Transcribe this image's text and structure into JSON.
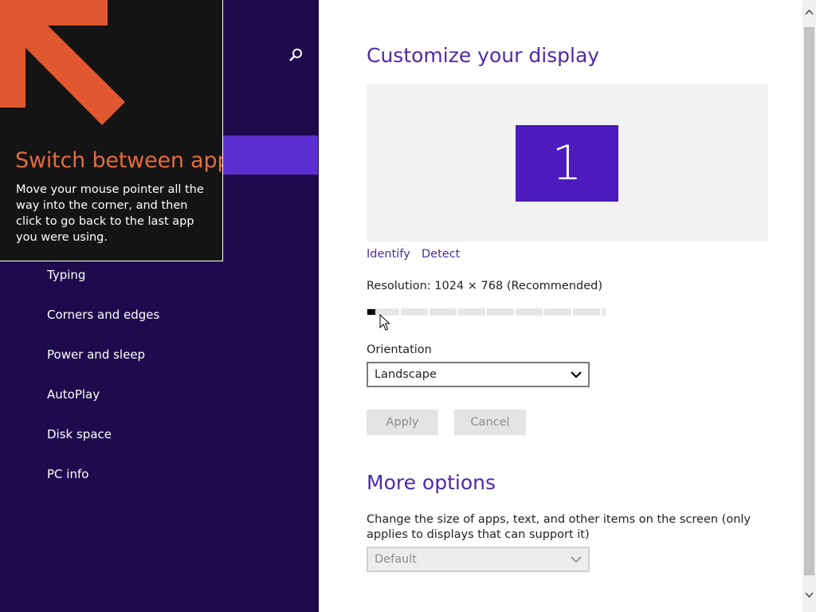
{
  "nav": {
    "items": [
      {
        "label": "Typing"
      },
      {
        "label": "Corners and edges"
      },
      {
        "label": "Power and sleep"
      },
      {
        "label": "AutoPlay"
      },
      {
        "label": "Disk space"
      },
      {
        "label": "PC info"
      }
    ],
    "search_icon": "search-icon"
  },
  "tip": {
    "title": "Switch between apps",
    "body": "Move your mouse pointer all the way into the corner, and then click to go back to the last app you were using.",
    "arrow_color": "#e0582f",
    "arrow_icon": "arrow-up-left-icon"
  },
  "display": {
    "heading": "Customize your display",
    "monitor_number": "1",
    "identify_label": "Identify",
    "detect_label": "Detect",
    "resolution_label": "Resolution: 1024 × 768 (Recommended)",
    "resolution_position": 0,
    "orientation_label": "Orientation",
    "orientation_value": "Landscape",
    "apply_label": "Apply",
    "cancel_label": "Cancel"
  },
  "more": {
    "heading": "More options",
    "description": "Change the size of apps, text, and other items on the screen (only applies to displays that can support it)",
    "size_value": "Default"
  },
  "colors": {
    "nav_background": "#1f0a4d",
    "accent": "#4d1bbd",
    "heading": "#4b2aa8"
  }
}
